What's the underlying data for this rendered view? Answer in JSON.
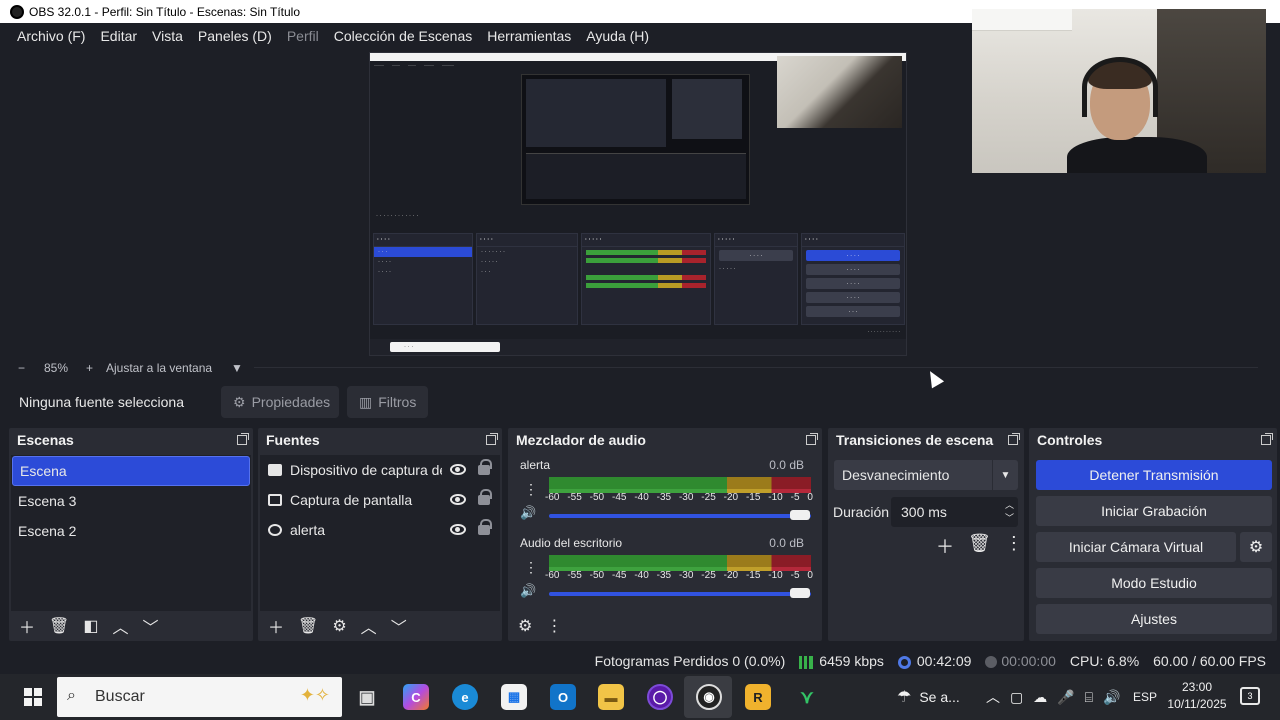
{
  "window": {
    "title": "OBS 32.0.1 - Perfil: Sin Título - Escenas: Sin Título"
  },
  "menu": {
    "items": [
      "Archivo (F)",
      "Editar",
      "Vista",
      "Paneles (D)",
      "Perfil",
      "Colección de Escenas",
      "Herramientas",
      "Ayuda (H)"
    ]
  },
  "zoom": {
    "minus": "−",
    "value": "85%",
    "plus": "+",
    "fit_label": "Ajustar a la ventana"
  },
  "source_toolbar": {
    "no_source": "Ninguna fuente selecciona",
    "properties": "Propiedades",
    "filters": "Filtros"
  },
  "scenes": {
    "title": "Escenas",
    "items": [
      "Escena",
      "Escena 3",
      "Escena 2"
    ],
    "selected": "Escena"
  },
  "sources": {
    "title": "Fuentes",
    "items": [
      {
        "name": "Dispositivo de captura de",
        "icon": "camera-icon"
      },
      {
        "name": "Captura de pantalla",
        "icon": "monitor-icon"
      },
      {
        "name": "alerta",
        "icon": "globe-icon"
      }
    ]
  },
  "mixer": {
    "title": "Mezclador de audio",
    "ticks": [
      "-60",
      "-55",
      "-50",
      "-45",
      "-40",
      "-35",
      "-30",
      "-25",
      "-20",
      "-15",
      "-10",
      "-5",
      "0"
    ],
    "channels": [
      {
        "name": "alerta",
        "db": "0.0 dB",
        "level": 1.0
      },
      {
        "name": "Audio del escritorio",
        "db": "0.0 dB",
        "level": 1.0
      }
    ]
  },
  "transitions": {
    "title": "Transiciones de escena",
    "selected": "Desvanecimiento",
    "duration_label": "Duración",
    "duration_value": "300 ms"
  },
  "controls": {
    "title": "Controles",
    "stop_stream": "Detener Transmisión",
    "start_record": "Iniciar Grabación",
    "virtual_cam": "Iniciar Cámara Virtual",
    "studio_mode": "Modo Estudio",
    "settings": "Ajustes"
  },
  "status": {
    "dropped": "Fotogramas Perdidos 0 (0.0%)",
    "bitrate": "6459 kbps",
    "live_time": "00:42:09",
    "rec_time": "00:00:00",
    "cpu": "CPU: 6.8%",
    "fps": "60.00 / 60.00 FPS"
  },
  "taskbar": {
    "search_placeholder": "Buscar",
    "weather": "Se a...",
    "lang": "ESP",
    "time": "23:00",
    "date": "10/11/2025",
    "notifications": "3"
  },
  "colors": {
    "accent": "#2c4bd8",
    "background": "#1d1f26",
    "dock": "#2a2c34"
  }
}
